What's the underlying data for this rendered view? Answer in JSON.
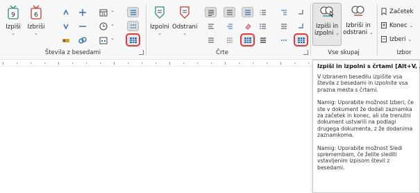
{
  "groups": {
    "stevila": {
      "label": "Števila z besedami",
      "izpisi": "Izpiši",
      "izbrisi": "Izbriši"
    },
    "crte": {
      "label": "Črte",
      "izpolni": "Izpolni",
      "odstrani": "Odstrani"
    },
    "vse": {
      "label": "Vse skupaj",
      "izpisi_line1": "Izpiši in",
      "izpisi_line2": "izpolni",
      "izbrisi_line1": "Izbriši in",
      "izbrisi_line2": "odstrani"
    },
    "izbor": {
      "label": "Izbor",
      "zacetek": "Začetek",
      "konec": "Konec",
      "izberi": "Izberi"
    }
  },
  "tooltip": {
    "title": "Izpiši in izpolni s črtami [Alt+V, A]",
    "p1": "V izbranem besedilu izpišite vsa števila z besedami in izpolnite vsa prazna mesta s črtami.",
    "p2": "Namig: Uporabite možnost Izberi, če ste v dokument že dodali zaznamka za začetek in konec, ali ste trenutni dokument ustvarili na podlagi drugega dokumenta, z že dodanima zaznamkoma.",
    "p3": "Namig: Uporabite možnost Sledi spremembam, če želite slediti vstavljenim izpisom števil z besedami."
  },
  "colors": {
    "accent_red": "#e03a3a",
    "teal": "#2a8a7e",
    "blue": "#2b6cb0",
    "gold": "#d4a017"
  }
}
